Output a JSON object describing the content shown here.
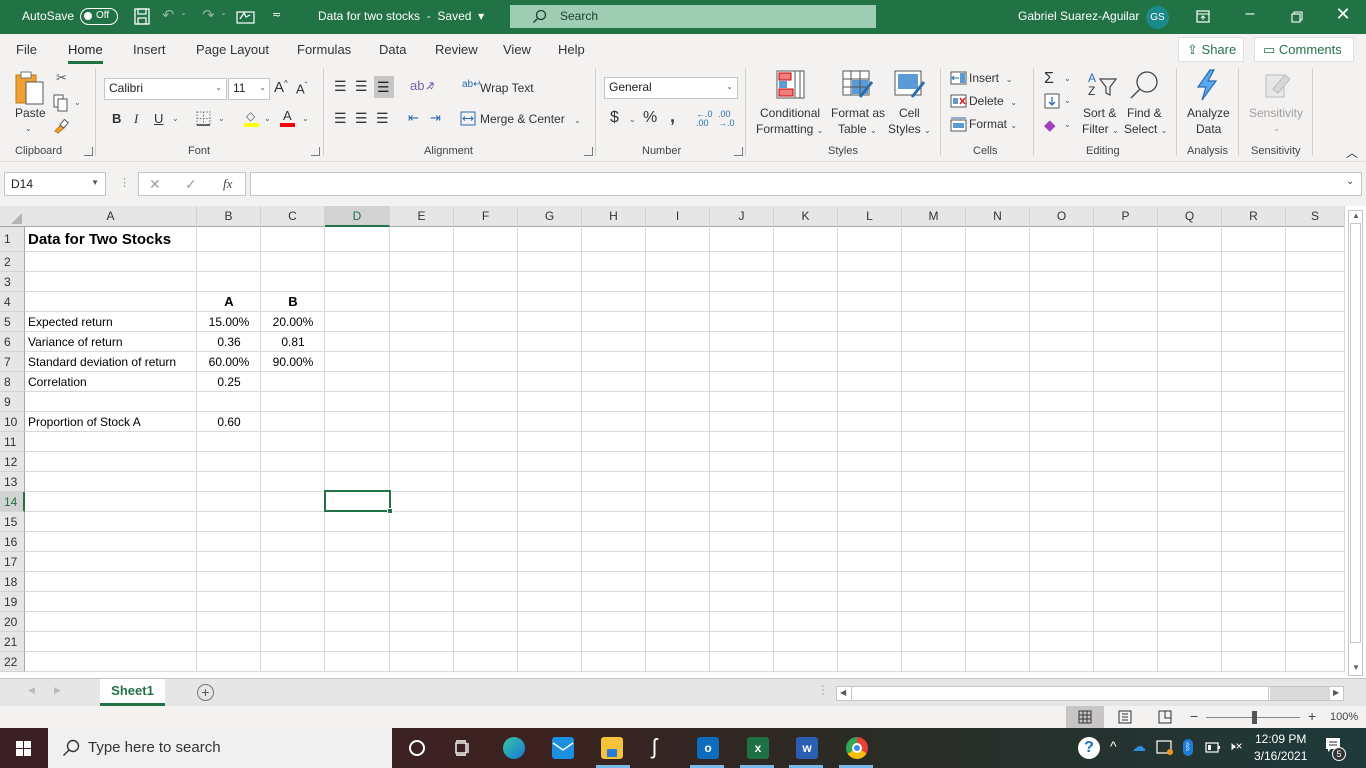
{
  "titlebar": {
    "autosave_label": "AutoSave",
    "autosave_state": "Off",
    "document_title": "Data for two stocks",
    "save_status": "Saved",
    "search_placeholder": "Search",
    "user_name": "Gabriel Suarez-Aguilar",
    "user_initials": "GS"
  },
  "menu": {
    "tabs": [
      "File",
      "Home",
      "Insert",
      "Page Layout",
      "Formulas",
      "Data",
      "Review",
      "View",
      "Help"
    ],
    "active_tab": "Home",
    "share_label": "Share",
    "comments_label": "Comments"
  },
  "ribbon": {
    "clipboard": {
      "paste_label": "Paste",
      "group_label": "Clipboard"
    },
    "font": {
      "font_name": "Calibri",
      "font_size": "11",
      "bold": "B",
      "italic": "I",
      "underline": "U",
      "group_label": "Font"
    },
    "alignment": {
      "wrap_text_label": "Wrap Text",
      "merge_center_label": "Merge & Center",
      "group_label": "Alignment"
    },
    "number": {
      "format_value": "General",
      "currency": "$",
      "percent": "%",
      "comma": ",",
      "group_label": "Number"
    },
    "styles": {
      "conditional_line1": "Conditional",
      "conditional_line2": "Formatting",
      "format_table_line1": "Format as",
      "format_table_line2": "Table",
      "cell_styles_line1": "Cell",
      "cell_styles_line2": "Styles",
      "group_label": "Styles"
    },
    "cells": {
      "insert_label": "Insert",
      "delete_label": "Delete",
      "format_label": "Format",
      "group_label": "Cells"
    },
    "editing": {
      "sort_line1": "Sort &",
      "sort_line2": "Filter",
      "find_line1": "Find &",
      "find_line2": "Select",
      "group_label": "Editing"
    },
    "analysis": {
      "analyze_line1": "Analyze",
      "analyze_line2": "Data",
      "group_label": "Analysis"
    },
    "sensitivity": {
      "label": "Sensitivity",
      "group_label": "Sensitivity"
    }
  },
  "formula_bar": {
    "name_box": "D14",
    "fx_label": "fx",
    "formula_value": ""
  },
  "sheet": {
    "columns": [
      "A",
      "B",
      "C",
      "D",
      "E",
      "F",
      "G",
      "H",
      "I",
      "J",
      "K",
      "L",
      "M",
      "N",
      "O",
      "P",
      "Q",
      "R",
      "S"
    ],
    "selected_column": "D",
    "rows": [
      "1",
      "2",
      "3",
      "4",
      "5",
      "6",
      "7",
      "8",
      "9",
      "10",
      "11",
      "12",
      "13",
      "14",
      "15",
      "16",
      "17",
      "18",
      "19",
      "20",
      "21",
      "22"
    ],
    "selected_row": "14",
    "cells": {
      "A1": "Data for Two Stocks",
      "B4": "A",
      "C4": "B",
      "A5": "Expected return",
      "B5": "15.00%",
      "C5": "20.00%",
      "A6": "Variance of return",
      "B6": "0.36",
      "C6": "0.81",
      "A7": "Standard deviation of return",
      "B7": "60.00%",
      "C7": "90.00%",
      "A8": "Correlation",
      "B8": "0.25",
      "A10": "Proportion of Stock A",
      "B10": "0.60"
    }
  },
  "sheet_tabs": {
    "tabs": [
      "Sheet1"
    ],
    "active": "Sheet1"
  },
  "statusbar": {
    "zoom": "100%",
    "zoom_minus": "−",
    "zoom_plus": "+"
  },
  "taskbar": {
    "search_placeholder": "Type here to search",
    "time": "12:09 PM",
    "date": "3/16/2021",
    "notification_count": "5"
  }
}
